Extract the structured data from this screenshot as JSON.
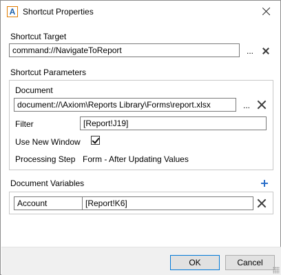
{
  "window": {
    "title": "Shortcut Properties",
    "app_icon_glyph": "A"
  },
  "shortcut_target": {
    "label": "Shortcut Target",
    "value": "command://NavigateToReport",
    "browse_label": "..."
  },
  "shortcut_parameters": {
    "label": "Shortcut Parameters",
    "document": {
      "label": "Document",
      "value": "document://\\Axiom\\Reports Library\\Forms\\report.xlsx",
      "browse_label": "..."
    },
    "filter": {
      "label": "Filter",
      "value": "[Report!J19]"
    },
    "use_new_window": {
      "label": "Use New Window",
      "checked": true
    },
    "processing_step": {
      "label": "Processing Step",
      "value": "Form - After Updating Values"
    }
  },
  "document_variables": {
    "label": "Document Variables",
    "rows": [
      {
        "name": "Account",
        "value": "[Report!K6]"
      }
    ]
  },
  "buttons": {
    "ok": "OK",
    "cancel": "Cancel"
  },
  "colors": {
    "accent": "#0078d7",
    "add_icon": "#2a6fc9",
    "footer_bg": "#f0f0f0"
  }
}
